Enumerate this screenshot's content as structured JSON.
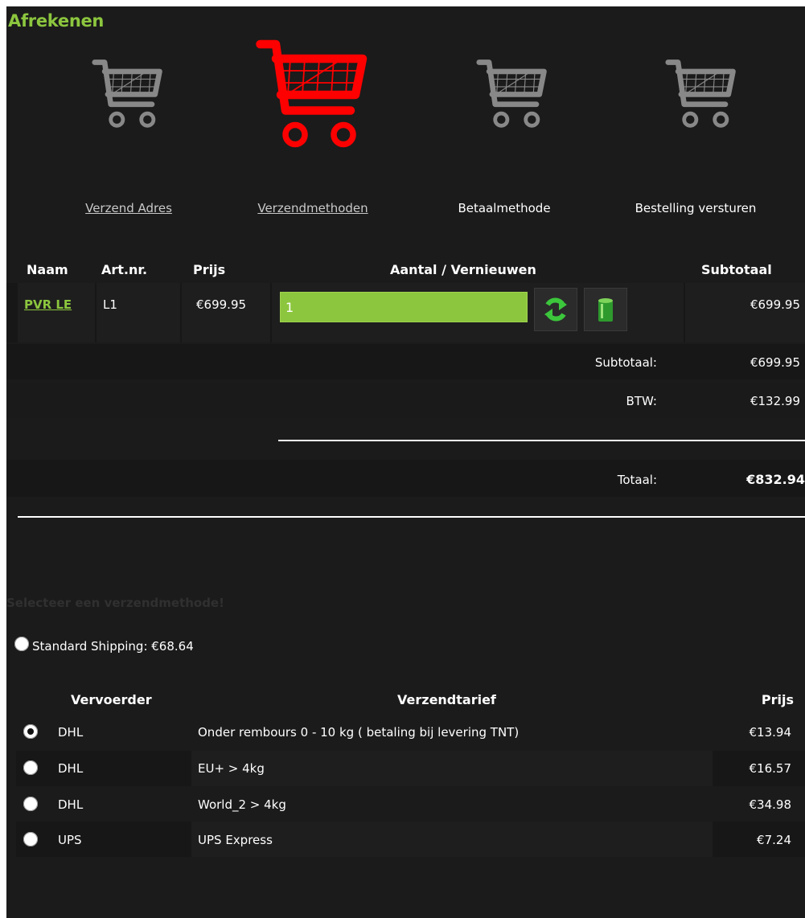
{
  "page": {
    "title": "Afrekenen"
  },
  "steps": [
    {
      "label": "Verzend Adres",
      "link": true,
      "active": false
    },
    {
      "label": "Verzendmethoden",
      "link": true,
      "active": true
    },
    {
      "label": "Betaalmethode",
      "link": false,
      "active": false
    },
    {
      "label": "Bestelling versturen",
      "link": false,
      "active": false
    }
  ],
  "cart_table": {
    "headers": {
      "name": "Naam",
      "art": "Art.nr.",
      "price": "Prijs",
      "qty": "Aantal / Vernieuwen",
      "subtotal": "Subtotaal"
    },
    "rows": [
      {
        "name": "PVR LE",
        "art": "L1",
        "price": "€699.95",
        "qty": "1",
        "subtotal": "€699.95"
      }
    ]
  },
  "totals": {
    "subtotal_label": "Subtotaal:",
    "subtotal_value": "€699.95",
    "vat_label": "BTW:",
    "vat_value": "€132.99",
    "total_label": "Totaal:",
    "total_value": "€832.94"
  },
  "shipping": {
    "heading": "Selecteer een verzendmethode!",
    "standard": "Standard Shipping: €68.64",
    "headers": {
      "carrier": "Vervoerder",
      "rate": "Verzendtarief",
      "price": "Prijs"
    },
    "options": [
      {
        "carrier": "DHL",
        "rate": "Onder rembours 0 - 10 kg ( betaling bij levering TNT)",
        "price": "€13.94",
        "selected": true
      },
      {
        "carrier": "DHL",
        "rate": "EU+ > 4kg",
        "price": "€16.57",
        "selected": false
      },
      {
        "carrier": "DHL",
        "rate": "World_2 > 4kg",
        "price": "€34.98",
        "selected": false
      },
      {
        "carrier": "UPS",
        "rate": "UPS Express",
        "price": "€7.24",
        "selected": false
      }
    ]
  },
  "colors": {
    "accent": "#8cc63e",
    "active_step": "#ff0000",
    "inactive_step": "#888888",
    "panel": "#1b1b1b"
  },
  "icons": {
    "step": "shopping-cart-icon",
    "refresh": "refresh-icon",
    "delete": "trash-icon"
  }
}
